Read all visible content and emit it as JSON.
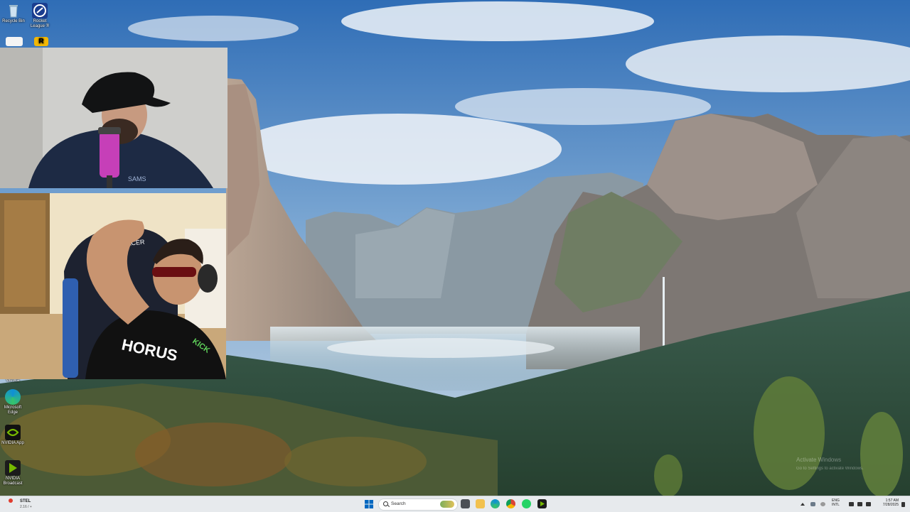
{
  "desktop": {
    "icons": [
      {
        "name": "Recycle Bin",
        "label": "Recycle Bin"
      },
      {
        "name": "Rocket League",
        "label": "Rocket League ®"
      },
      {
        "name": "Webca",
        "label": "Webca"
      },
      {
        "name": "Microsoft Edge",
        "label": "Microsoft Edge"
      },
      {
        "name": "NVIDIA App",
        "label": "NVIDIA App"
      },
      {
        "name": "NVIDIA Broadcast",
        "label": "NVIDIA Broadcast"
      }
    ],
    "watermark": {
      "line1": "Activate Windows",
      "line2": "Go to Settings to activate Windows."
    }
  },
  "webcams": {
    "top": {
      "overlay_text": "SAMS"
    },
    "bottom": {
      "chair_brand": "DXRACER",
      "shirt_text": "HORUS",
      "badge_text": "KICK"
    }
  },
  "taskbar": {
    "weather": {
      "ticker": "STEL",
      "value": "2.16 / +"
    },
    "search_placeholder": "Search",
    "apps": [
      "file-explorer",
      "microsoft-edge",
      "chrome",
      "whatsapp",
      "nvidia-app"
    ],
    "tray": {
      "lang_line1": "ENG",
      "lang_line2": "INTL",
      "time": "1:57 AM",
      "date": "7/28/2025"
    }
  },
  "colors": {
    "taskbar_bg": "#e7eaed",
    "accent": "#0067c0"
  }
}
